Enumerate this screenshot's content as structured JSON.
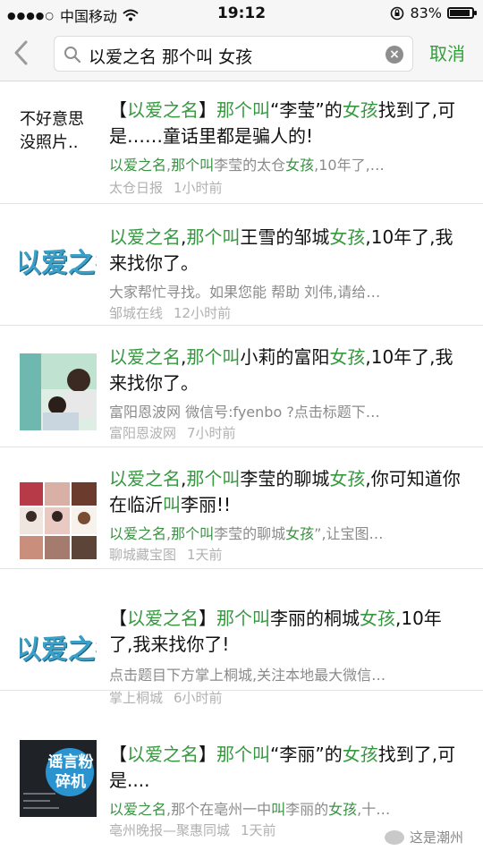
{
  "status_bar": {
    "signal": "●●●●○",
    "carrier": "中国移动",
    "time": "19:12",
    "battery": "83%",
    "battery_level": 0.83
  },
  "search": {
    "query": "以爱之名 那个叫 女孩",
    "cancel_label": "取消"
  },
  "results": [
    {
      "thumb_text": "不好意思没照片..",
      "title_parts": [
        {
          "t": "【",
          "hl": false
        },
        {
          "t": "以爱之名",
          "hl": true
        },
        {
          "t": "】",
          "hl": false
        },
        {
          "t": "那个叫",
          "hl": true
        },
        {
          "t": "“李莹”的",
          "hl": false
        },
        {
          "t": "女孩",
          "hl": true
        },
        {
          "t": "找到了,可是……童话里都是骗人的!",
          "hl": false
        }
      ],
      "snippet_parts": [
        {
          "t": "以爱之名",
          "hl": true
        },
        {
          "t": ",",
          "hl": false
        },
        {
          "t": "那个叫",
          "hl": true
        },
        {
          "t": "李莹的太仓",
          "hl": false
        },
        {
          "t": "女孩",
          "hl": true
        },
        {
          "t": ",10年了,…",
          "hl": false
        }
      ],
      "source": "太仓日报",
      "time": "1小时前"
    },
    {
      "thumb_text": "以爱之名",
      "title_parts": [
        {
          "t": "以爱之名",
          "hl": true
        },
        {
          "t": ",",
          "hl": false
        },
        {
          "t": "那个叫",
          "hl": true
        },
        {
          "t": "王雪的邹城",
          "hl": false
        },
        {
          "t": "女孩",
          "hl": true
        },
        {
          "t": ",10年了,我来找你了。",
          "hl": false
        }
      ],
      "snippet_parts": [
        {
          "t": "大家帮忙寻找。如果您能 帮助 刘伟,请给…",
          "hl": false
        }
      ],
      "source": "邹城在线",
      "time": "12小时前"
    },
    {
      "thumb_text": "",
      "title_parts": [
        {
          "t": "以爱之名",
          "hl": true
        },
        {
          "t": ",",
          "hl": false
        },
        {
          "t": "那个叫",
          "hl": true
        },
        {
          "t": "小莉的富阳",
          "hl": false
        },
        {
          "t": "女孩",
          "hl": true
        },
        {
          "t": ",10年了,我来找你了。",
          "hl": false
        }
      ],
      "snippet_parts": [
        {
          "t": "富阳恩波网 微信号:fyenbo ?点击标题下…",
          "hl": false
        }
      ],
      "source": "富阳恩波网",
      "time": "7小时前"
    },
    {
      "thumb_text": "",
      "title_parts": [
        {
          "t": "以爱之名",
          "hl": true
        },
        {
          "t": ",",
          "hl": false
        },
        {
          "t": "那个叫",
          "hl": true
        },
        {
          "t": "李莹的聊城",
          "hl": false
        },
        {
          "t": "女孩",
          "hl": true
        },
        {
          "t": ",你可知道你在临沂",
          "hl": false
        },
        {
          "t": "叫",
          "hl": true
        },
        {
          "t": "李丽!!",
          "hl": false
        }
      ],
      "snippet_parts": [
        {
          "t": "以爱之名",
          "hl": true
        },
        {
          "t": ",",
          "hl": false
        },
        {
          "t": "那个叫",
          "hl": true
        },
        {
          "t": "李莹的聊城",
          "hl": false
        },
        {
          "t": "女孩",
          "hl": true
        },
        {
          "t": "”,让宝图…",
          "hl": false
        }
      ],
      "source": "聊城藏宝图",
      "time": "1天前"
    },
    {
      "thumb_text": "以爱之名",
      "title_parts": [
        {
          "t": "【",
          "hl": false
        },
        {
          "t": "以爱之名",
          "hl": true
        },
        {
          "t": "】",
          "hl": false
        },
        {
          "t": "那个叫",
          "hl": true
        },
        {
          "t": "李丽的桐城",
          "hl": false
        },
        {
          "t": "女孩",
          "hl": true
        },
        {
          "t": ",10年了,我来找你了!",
          "hl": false
        }
      ],
      "snippet_parts": [
        {
          "t": "点击题目下方掌上桐城,关注本地最大微信…",
          "hl": false
        }
      ],
      "source": "掌上桐城",
      "time": "6小时前"
    },
    {
      "thumb_text": "谣言粉碎机",
      "title_parts": [
        {
          "t": "【",
          "hl": false
        },
        {
          "t": "以爱之名",
          "hl": true
        },
        {
          "t": "】",
          "hl": false
        },
        {
          "t": "那个叫",
          "hl": true
        },
        {
          "t": "“李丽”的",
          "hl": false
        },
        {
          "t": "女孩",
          "hl": true
        },
        {
          "t": "找到了,可是....",
          "hl": false
        }
      ],
      "snippet_parts": [
        {
          "t": "以爱之名",
          "hl": true
        },
        {
          "t": ",那个在亳州一中",
          "hl": false
        },
        {
          "t": "叫",
          "hl": true
        },
        {
          "t": "李丽的",
          "hl": false
        },
        {
          "t": "女孩",
          "hl": true
        },
        {
          "t": ",十…",
          "hl": false
        }
      ],
      "source": "亳州晚报—聚惠同城",
      "time": "1天前"
    }
  ],
  "watermark": "这是潮州",
  "colors": {
    "highlight": "#36983f",
    "cancel": "#31a039",
    "meta": "#b1b1b1"
  }
}
